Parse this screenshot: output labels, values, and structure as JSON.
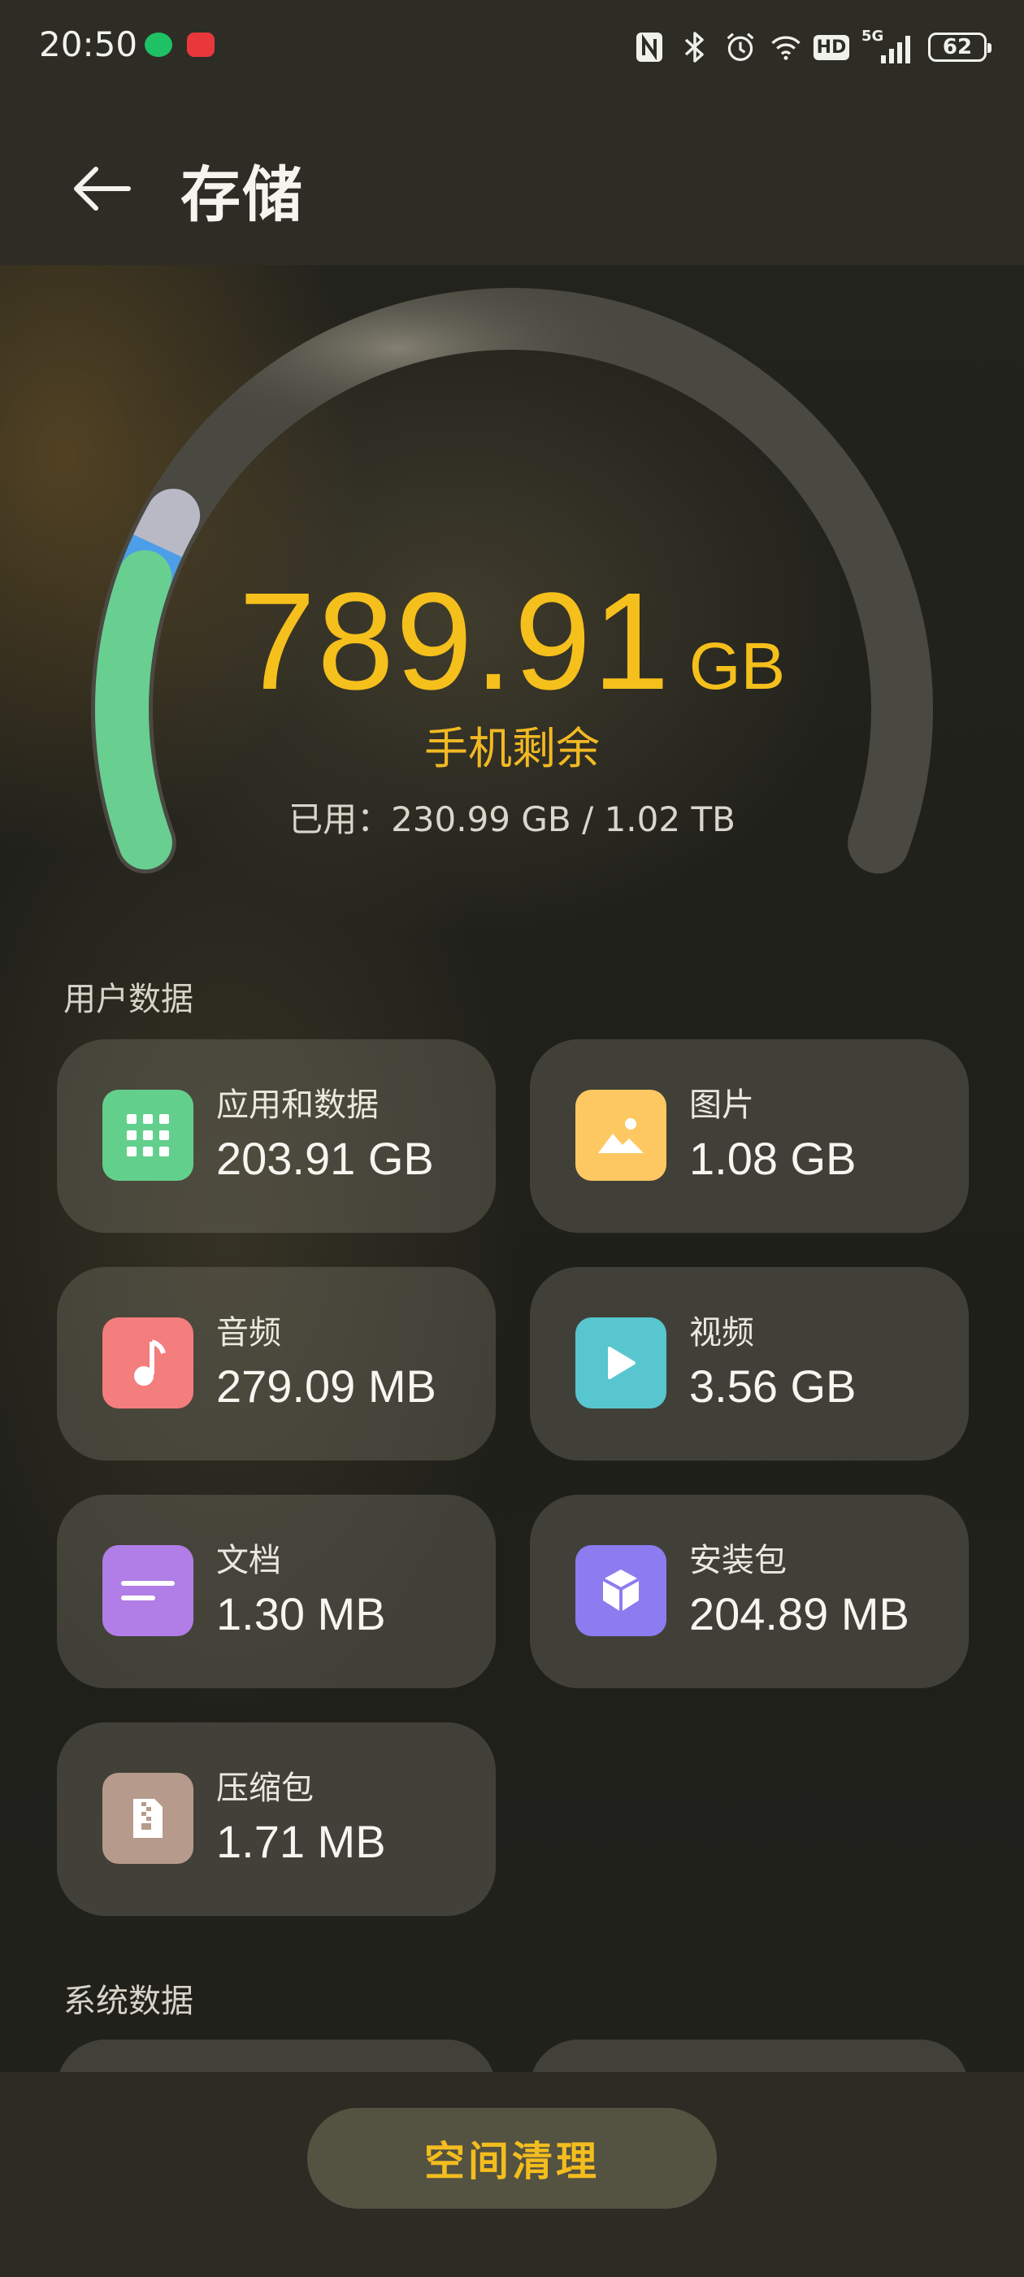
{
  "status_bar": {
    "time": "20:50",
    "battery": "62",
    "network": "5G",
    "hd": "HD"
  },
  "header": {
    "title": "存储"
  },
  "gauge": {
    "free_value": "789.91",
    "free_unit": "GB",
    "free_label": "手机剩余",
    "used_text": "已用：230.99 GB / 1.02 TB",
    "used_fraction": 0.226,
    "colors": {
      "apps": "#68cf91",
      "photos": "#4d9ee8",
      "other": "#b9b9c6",
      "track": "#4a4941",
      "accent": "#f5bf1c"
    }
  },
  "user_data": {
    "section_title": "用户数据",
    "items": [
      {
        "name": "应用和数据",
        "size": "203.91 GB",
        "icon": "apps-grid-icon",
        "color": "#63cf8c"
      },
      {
        "name": "图片",
        "size": "1.08 GB",
        "icon": "image-icon",
        "color": "#fdc862"
      },
      {
        "name": "音频",
        "size": "279.09 MB",
        "icon": "music-note-icon",
        "color": "#f47d7d"
      },
      {
        "name": "视频",
        "size": "3.56 GB",
        "icon": "play-icon",
        "color": "#58c6cf"
      },
      {
        "name": "文档",
        "size": "1.30 MB",
        "icon": "document-icon",
        "color": "#b07ee6"
      },
      {
        "name": "安装包",
        "size": "204.89 MB",
        "icon": "package-cube-icon",
        "color": "#8c7cf0"
      },
      {
        "name": "压缩包",
        "size": "1.71 MB",
        "icon": "zip-file-icon",
        "color": "#b69a8b"
      }
    ]
  },
  "system_data": {
    "section_title": "系统数据"
  },
  "footer": {
    "clean_label": "空间清理"
  }
}
